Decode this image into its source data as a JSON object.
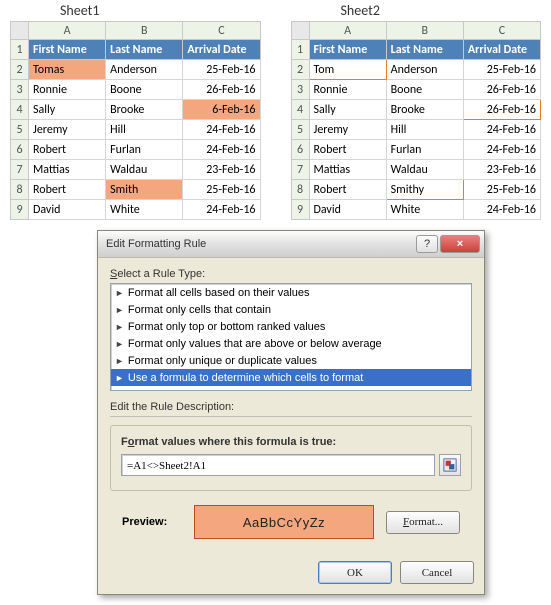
{
  "sheet1": {
    "label": "Sheet1",
    "cols": [
      "A",
      "B",
      "C"
    ],
    "headers": {
      "a": "First Name",
      "b": "Last Name",
      "c": "Arrival Date"
    },
    "rows": [
      {
        "n": "2",
        "a": "Tomas",
        "b": "Anderson",
        "c": "25-Feb-16",
        "hl": [
          "a"
        ]
      },
      {
        "n": "3",
        "a": "Ronnie",
        "b": "Boone",
        "c": "26-Feb-16"
      },
      {
        "n": "4",
        "a": "Sally",
        "b": "Brooke",
        "c": "6-Feb-16",
        "hl": [
          "c"
        ]
      },
      {
        "n": "5",
        "a": "Jeremy",
        "b": "Hill",
        "c": "24-Feb-16"
      },
      {
        "n": "6",
        "a": "Robert",
        "b": "Furlan",
        "c": "24-Feb-16"
      },
      {
        "n": "7",
        "a": "Mattias",
        "b": "Waldau",
        "c": "23-Feb-16"
      },
      {
        "n": "8",
        "a": "Robert",
        "b": "Smith",
        "c": "25-Feb-16",
        "hl": [
          "b"
        ]
      },
      {
        "n": "9",
        "a": "David",
        "b": "White",
        "c": "24-Feb-16"
      }
    ]
  },
  "sheet2": {
    "label": "Sheet2",
    "cols": [
      "A",
      "B",
      "C"
    ],
    "headers": {
      "a": "First Name",
      "b": "Last Name",
      "c": "Arrival Date"
    },
    "rows": [
      {
        "n": "2",
        "a": "Tom",
        "b": "Anderson",
        "c": "25-Feb-16",
        "diff": [
          "a"
        ]
      },
      {
        "n": "3",
        "a": "Ronnie",
        "b": "Boone",
        "c": "26-Feb-16"
      },
      {
        "n": "4",
        "a": "Sally",
        "b": "Brooke",
        "c": "26-Feb-16",
        "diff": [
          "c"
        ]
      },
      {
        "n": "5",
        "a": "Jeremy",
        "b": "Hill",
        "c": "24-Feb-16"
      },
      {
        "n": "6",
        "a": "Robert",
        "b": "Furlan",
        "c": "24-Feb-16"
      },
      {
        "n": "7",
        "a": "Mattias",
        "b": "Waldau",
        "c": "23-Feb-16"
      },
      {
        "n": "8",
        "a": "Robert",
        "b": "Smithy",
        "c": "25-Feb-16",
        "diff": [
          "b"
        ]
      },
      {
        "n": "9",
        "a": "David",
        "b": "White",
        "c": "24-Feb-16"
      }
    ]
  },
  "dialog": {
    "title": "Edit Formatting Rule",
    "rule_type_label": "Select a Rule Type:",
    "rule_types": [
      "Format all cells based on their values",
      "Format only cells that contain",
      "Format only top or bottom ranked values",
      "Format only values that are above or below average",
      "Format only unique or duplicate values",
      "Use a formula to determine which cells to format"
    ],
    "selected_rule_index": 5,
    "desc_label": "Edit the Rule Description:",
    "formula_label": "Format values where this formula is true:",
    "formula_value": "=A1<>Sheet2!A1",
    "preview_label": "Preview:",
    "preview_text": "AaBbCcYyZz",
    "format_btn": "Format...",
    "ok": "OK",
    "cancel": "Cancel",
    "help": "?",
    "close": "×"
  }
}
